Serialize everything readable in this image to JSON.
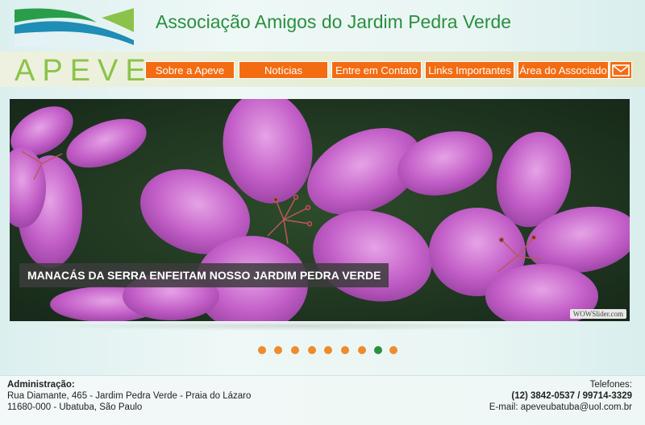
{
  "header": {
    "site_title": "Associação Amigos do Jardim Pedra Verde",
    "brand": "APEVE"
  },
  "nav": {
    "items": [
      {
        "label": "Sobre a Apeve"
      },
      {
        "label": "Notícias"
      },
      {
        "label": "Entre em Contato"
      },
      {
        "label": "Links Importantes"
      },
      {
        "label": "Área do Associado"
      }
    ],
    "mail_icon": "envelope-icon"
  },
  "slider": {
    "caption": "MANACÁS DA SERRA ENFEITAM NOSSO JARDIM PEDRA VERDE",
    "watermark": "WOWSlider.com",
    "slide_count": 9,
    "active_slide": 8
  },
  "footer": {
    "admin_label": "Administração:",
    "address_line1": "Rua Diamante, 465 - Jardim Pedra Verde - Praia do Lázaro",
    "address_line2": "11680-000 - Ubatuba, São Paulo",
    "phones_label": "Telefones:",
    "phones": "(12) 3842-0537 / 99714-3329",
    "email_line": "E-mail: apeveubatuba@uol.com.br"
  },
  "colors": {
    "accent_orange": "#f36c12",
    "brand_green": "#2a8f3f",
    "brand_light_green": "#8bc34a",
    "dot_orange": "#f08a2a"
  }
}
